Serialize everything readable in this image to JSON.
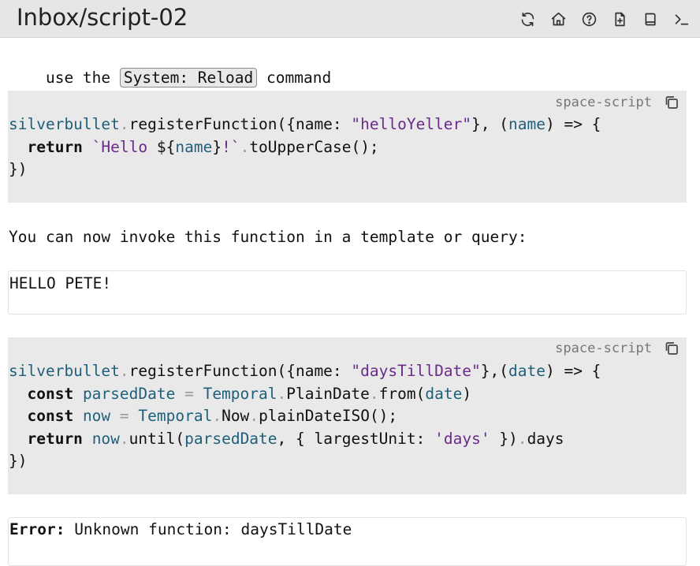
{
  "page": {
    "title": "Inbox/script-02"
  },
  "toolbar": {
    "icons": [
      "sync-icon",
      "home-icon",
      "help-icon",
      "new-page-icon",
      "book-icon",
      "terminal-icon"
    ]
  },
  "intro": {
    "before": "use the ",
    "command": "System: Reload",
    "after": " command"
  },
  "block1": {
    "lang": "space-script",
    "l1": {
      "a": "silverbullet",
      "b": ".",
      "c": "registerFunction({name: ",
      "d": "\"helloYeller\"",
      "e": "}, (",
      "f": "name",
      "g": ") => {"
    },
    "l2": {
      "a": "  ",
      "b": "return",
      "c": " ",
      "d": "`Hello ",
      "e": "${",
      "f": "name",
      "g": "}",
      "h": "!`",
      "i": ".",
      "j": "toUpperCase();"
    },
    "l3": "})"
  },
  "para": "You can now invoke this function in a template or query:",
  "result1": "HELLO PETE!",
  "block2": {
    "lang": "space-script",
    "l1": {
      "a": "silverbullet",
      "b": ".",
      "c": "registerFunction({name: ",
      "d": "\"daysTillDate\"",
      "e": "},(",
      "f": "date",
      "g": ") => {"
    },
    "l2": {
      "a": "  ",
      "b": "const",
      "c": " ",
      "d": "parsedDate",
      "e": " = ",
      "f": "Temporal",
      "g": ".",
      "h": "PlainDate",
      "i": ".",
      "j": "from(",
      "k": "date",
      "l": ")"
    },
    "l3": {
      "a": "  ",
      "b": "const",
      "c": " ",
      "d": "now",
      "e": " = ",
      "f": "Temporal",
      "g": ".",
      "h": "Now",
      "i": ".",
      "j": "plainDateISO();"
    },
    "l4": {
      "a": "  ",
      "b": "return",
      "c": " ",
      "d": "now",
      "e": ".",
      "f": "until(",
      "g": "parsedDate",
      "h": ", { largestUnit: ",
      "i": "'days'",
      "j": " })",
      "k": ".",
      "l": "days"
    },
    "l5": "})"
  },
  "error": {
    "label": "Error:",
    "message": " Unknown function: daysTillDate"
  }
}
